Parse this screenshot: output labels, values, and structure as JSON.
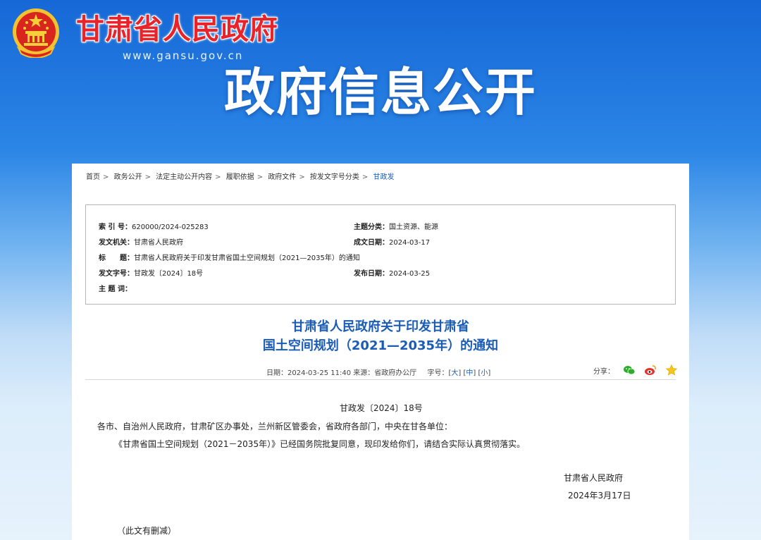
{
  "header": {
    "site_name": "甘肃省人民政府",
    "site_url": "www.gansu.gov.cn",
    "section_title": "政府信息公开"
  },
  "breadcrumb": [
    "首页",
    "政务公开",
    "法定主动公开内容",
    "履职依据",
    "政府文件",
    "按发文字号分类",
    "甘政发"
  ],
  "meta": {
    "index_label": "索 引 号：",
    "index_value": "620000/2024-025283",
    "topic_label": "主题分类：",
    "topic_value": "国土资源、能源",
    "issuer_label": "发文机关：",
    "issuer_value": "甘肃省人民政府",
    "created_label": "成文日期：",
    "created_value": "2024-03-17",
    "title_label": "标　　题：",
    "title_value": "甘肃省人民政府关于印发甘肃省国土空间规划（2021—2035年）的通知",
    "docno_label": "发文字号：",
    "docno_value": "甘政发〔2024〕18号",
    "published_label": "发布日期：",
    "published_value": "2024-03-25",
    "keywords_label": "主 题 词："
  },
  "document": {
    "title_line1": "甘肃省人民政府关于印发甘肃省",
    "title_line2": "国土空间规划（2021—2035年）的通知",
    "date_info": "日期：2024-03-25 11:40  来源：省政府办公厅",
    "font_label": "字号：",
    "font_large": "大",
    "font_medium": "中",
    "font_small": "小",
    "share_label": "分享：",
    "doc_number": "甘政发〔2024〕18号",
    "recipients": "各市、自治州人民政府，甘肃矿区办事处，兰州新区管委会，省政府各部门，中央在甘各单位：",
    "paragraph1": "《甘肃省国土空间规划（2021－2035年）》已经国务院批复同意，现印发给你们，请结合实际认真贯彻落实。",
    "signature": "甘肃省人民政府",
    "sign_date": "2024年3月17日",
    "note": "（此文有删减）"
  },
  "colors": {
    "accent": "#1a5cb5",
    "site_name": "#e8232a"
  },
  "icons": [
    "national-emblem-icon",
    "wechat-icon",
    "weibo-icon",
    "favorite-star-icon"
  ]
}
